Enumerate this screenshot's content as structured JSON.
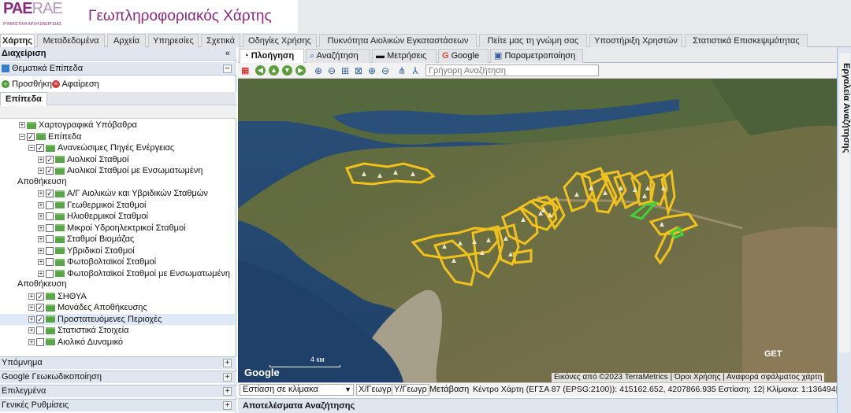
{
  "header": {
    "logo_main": "PAE",
    "logo_alt": "RAE",
    "logo_sub": "ΡΥΘΜΙΣΤΙΚΗ ΑΡΧΗ ΕΝΕΡΓΕΙΑΣ",
    "title": "Γεωπληροφοριακός Χάρτης",
    "accent": "#8a2a7f"
  },
  "main_tabs": [
    {
      "label": "Χάρτης",
      "active": true
    },
    {
      "label": "Μεταδεδομένα"
    },
    {
      "label": "Αρχεία"
    },
    {
      "label": "Υπηρεσίες"
    },
    {
      "label": "Σχετικά"
    },
    {
      "label": "Οδηγίες Χρήσης"
    },
    {
      "label": "Πυκνότητα Αιολικών Εγκαταστάσεων"
    },
    {
      "label": "Πείτε μας τη γνώμη σας"
    },
    {
      "label": "Υποστήριξη Χρηστών"
    },
    {
      "label": "Στατιστικά Επισκεψιμότητας"
    }
  ],
  "left_panel": {
    "title": "Διαχείριση",
    "collapse_icon": "double-chevron-left-icon",
    "section_title": "Θεματικά Επίπεδα",
    "add_label": "Προσθήκη",
    "remove_label": "Αφαίρεση",
    "layers_tab": "Επίπεδα",
    "tree": [
      {
        "label": "Χαρτογραφικά Υπόβαθρα",
        "indent": 1,
        "expand": "+",
        "checkbox": false
      },
      {
        "label": "Επίπεδα",
        "indent": 1,
        "expand": "−",
        "checkbox": true,
        "checked": true
      },
      {
        "label": "Ανανεώσιμες Πηγές Ενέργειας",
        "indent": 2,
        "expand": "−",
        "checkbox": true,
        "checked": true
      },
      {
        "label": "Αιολικοί Σταθμοί",
        "indent": 3,
        "expand": "+",
        "checkbox": true,
        "checked": true
      },
      {
        "label": "Αιολικοί Σταθμοί με Ενσωματωμένη",
        "indent": 3,
        "expand": "+",
        "checkbox": true,
        "checked": true,
        "wrap": "Αποθήκευση"
      },
      {
        "label": "Α/Γ Αιολικών και Υβριδικών Σταθμών",
        "indent": 3,
        "expand": "+",
        "checkbox": true,
        "checked": true
      },
      {
        "label": "Γεωθερμικοί Σταθμοί",
        "indent": 3,
        "expand": "+",
        "checkbox": true,
        "checked": false
      },
      {
        "label": "Ηλιοθερμικοί Σταθμοί",
        "indent": 3,
        "expand": "+",
        "checkbox": true,
        "checked": false
      },
      {
        "label": "Μικροί Υδροηλεκτρικοί Σταθμοί",
        "indent": 3,
        "expand": "+",
        "checkbox": true,
        "checked": false
      },
      {
        "label": "Σταθμοί Βιομάζας",
        "indent": 3,
        "expand": "+",
        "checkbox": true,
        "checked": false
      },
      {
        "label": "Υβριδικοί Σταθμοί",
        "indent": 3,
        "expand": "+",
        "checkbox": true,
        "checked": false
      },
      {
        "label": "Φωτοβολταϊκοί Σταθμοί",
        "indent": 3,
        "expand": "+",
        "checkbox": true,
        "checked": false
      },
      {
        "label": "Φωτοβολταϊκοί Σταθμοί με Ενσωματωμένη",
        "indent": 3,
        "expand": "+",
        "checkbox": true,
        "checked": false,
        "wrap": "Αποθήκευση"
      },
      {
        "label": "ΣΗΘΥΑ",
        "indent": 2,
        "expand": "+",
        "checkbox": true,
        "checked": true
      },
      {
        "label": "Μονάδες Αποθήκευσης",
        "indent": 2,
        "expand": "+",
        "checkbox": true,
        "checked": true
      },
      {
        "label": "Προστατευόμενες Περιοχές",
        "indent": 2,
        "expand": "+",
        "checkbox": true,
        "checked": true,
        "selected": true
      },
      {
        "label": "Στατιστικά Στοιχεία",
        "indent": 2,
        "expand": "+",
        "checkbox": true,
        "checked": false
      },
      {
        "label": "Αιολικό Δυναμικό",
        "indent": 2,
        "expand": "+",
        "checkbox": true,
        "checked": false
      }
    ],
    "collapsed_sections": [
      "Υπόμνημα",
      "Google Γεωκωδικοποίηση",
      "Επιλεγμένα",
      "Γενικές Ρυθμίσεις"
    ]
  },
  "map_tabs": [
    {
      "label": "Πλοήγηση",
      "icon": "compass-icon",
      "active": true
    },
    {
      "label": "Αναζήτηση",
      "icon": "search-icon"
    },
    {
      "label": "Μετρήσεις",
      "icon": "ruler-icon"
    },
    {
      "label": "Google",
      "icon": "google-icon"
    },
    {
      "label": "Παραμετροποίηση",
      "icon": "settings-icon"
    }
  ],
  "map_toolbar": {
    "quick_search_placeholder": "Γρήγορη Αναζήτηση"
  },
  "map": {
    "google_logo": "Google",
    "scale_label": "4 км",
    "attribution": "Εικόνες από ©2023 TerraMetrics | Όροι Χρήσης | Αναφορά σφάλματος χάρτη",
    "get_logo": "GET",
    "polygon_color": "#f2c21c",
    "highlight_color": "#3fd43a"
  },
  "statusbar": {
    "scale_select": "Εστίαση σε κλίμακα",
    "x_label": "X/Γεωγρ",
    "y_label": "Y/Γεωγρ",
    "transfer_label": "Μετάβαση",
    "center_text": "Κέντρο Χάρτη (ΕΓΣΑ 87 (EPSG:2100)): 415162.652, 4207866.935 Εστίαση: 12| Κλίμακα: 1:136494|"
  },
  "results_panel": {
    "title": "Αποτελέσματα Αναζήτησης"
  },
  "right_panel": {
    "title": "Εργαλεία Αναζήτησης"
  }
}
